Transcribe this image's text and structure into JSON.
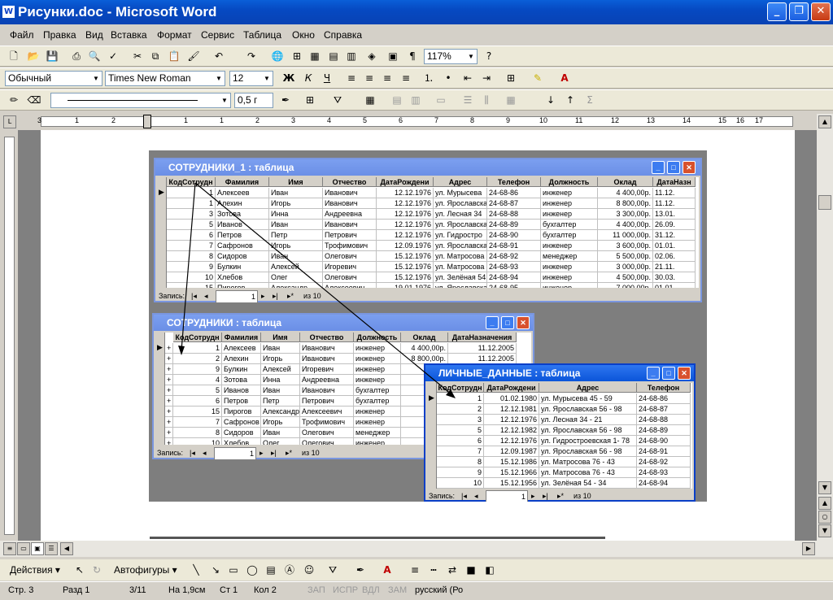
{
  "window": {
    "title": "Рисунки.doc - Microsoft Word"
  },
  "menu": [
    "Файл",
    "Правка",
    "Вид",
    "Вставка",
    "Формат",
    "Сервис",
    "Таблица",
    "Окно",
    "Справка"
  ],
  "toolbar": {
    "zoom": "117%"
  },
  "formatting": {
    "style": "Обычный",
    "font": "Times New Roman",
    "size": "12"
  },
  "drawing_line": {
    "weight": "0,5 г"
  },
  "ruler": {
    "numbers": [
      "3",
      "1",
      "2",
      "1",
      "1",
      "2",
      "3",
      "4",
      "5",
      "6",
      "7",
      "8",
      "9",
      "10",
      "11",
      "12",
      "13",
      "14",
      "15",
      "16",
      "17"
    ]
  },
  "w1": {
    "title": "СОТРУДНИКИ_1 : таблица",
    "headers": [
      "КодСотрудн",
      "Фамилия",
      "Имя",
      "Отчество",
      "ДатаРождени",
      "Адрес",
      "Телефон",
      "Должность",
      "Оклад",
      "ДатаНазн"
    ],
    "rows": [
      [
        "1",
        "Алексеев",
        "Иван",
        "Иванович",
        "12.12.1976",
        "ул. Мурысева",
        "24-68-86",
        "инженер",
        "4 400,00р.",
        "11.12."
      ],
      [
        "1",
        "Алехин",
        "Игорь",
        "Иванович",
        "12.12.1976",
        "ул. Ярославска",
        "24-68-87",
        "инженер",
        "8 800,00р.",
        "11.12."
      ],
      [
        "3",
        "Зотова",
        "Инна",
        "Андреевна",
        "12.12.1976",
        "ул. Лесная 34",
        "24-68-88",
        "инженер",
        "3 300,00р.",
        "13.01."
      ],
      [
        "5",
        "Иванов",
        "Иван",
        "Иванович",
        "12.12.1976",
        "ул. Ярославска",
        "24-68-89",
        "бухгалтер",
        "4 400,00р.",
        "26.09."
      ],
      [
        "6",
        "Петров",
        "Петр",
        "Петрович",
        "12.12.1976",
        "ул. Гидростро",
        "24-68-90",
        "бухгалтер",
        "11 000,00р.",
        "31.12."
      ],
      [
        "7",
        "Сафронов",
        "Игорь",
        "Трофимович",
        "12.09.1976",
        "ул. Ярославска",
        "24-68-91",
        "инженер",
        "3 600,00р.",
        "01.01."
      ],
      [
        "8",
        "Сидоров",
        "Иван",
        "Олегович",
        "15.12.1976",
        "ул. Матросова",
        "24-68-92",
        "менеджер",
        "5 500,00р.",
        "02.06."
      ],
      [
        "9",
        "Булкин",
        "Алексей",
        "Игоревич",
        "15.12.1976",
        "ул. Матросова",
        "24-68-93",
        "инженер",
        "3 000,00р.",
        "21.11."
      ],
      [
        "10",
        "Хлебов",
        "Олег",
        "Олегович",
        "15.12.1976",
        "ул. Зелёная 54",
        "24-68-94",
        "инженер",
        "4 500,00р.",
        "30.03."
      ],
      [
        "15",
        "Пирогов",
        "Александр",
        "Алексеевич",
        "19.01.1976",
        "ул. Ярославска",
        "24-68-95",
        "инженер",
        "7 000,00р.",
        "01.01."
      ]
    ],
    "nav_label": "Запись:",
    "nav_pos": "1",
    "nav_of": "из 10"
  },
  "w2": {
    "title": "СОТРУДНИКИ : таблица",
    "headers": [
      "КодСотрудн",
      "Фамилия",
      "Имя",
      "Отчество",
      "Должность",
      "Оклад",
      "ДатаНазначения"
    ],
    "rows": [
      [
        "1",
        "Алексеев",
        "Иван",
        "Иванович",
        "инженер",
        "4 400,00р.",
        "11.12.2005"
      ],
      [
        "2",
        "Алехин",
        "Игорь",
        "Иванович",
        "инженер",
        "8 800,00р.",
        "11.12.2005"
      ],
      [
        "9",
        "Булкин",
        "Алексей",
        "Игоревич",
        "инженер",
        "3 0",
        ""
      ],
      [
        "4",
        "Зотова",
        "Инна",
        "Андреевна",
        "инженер",
        "3 3",
        ""
      ],
      [
        "5",
        "Иванов",
        "Иван",
        "Иванович",
        "бухгалтер",
        "4 4",
        ""
      ],
      [
        "6",
        "Петров",
        "Петр",
        "Петрович",
        "бухгалтер",
        "11 0",
        ""
      ],
      [
        "15",
        "Пирогов",
        "Александр",
        "Алексеевич",
        "инженер",
        "7 0",
        ""
      ],
      [
        "7",
        "Сафронов",
        "Игорь",
        "Трофимович",
        "инженер",
        "3 6",
        ""
      ],
      [
        "8",
        "Сидоров",
        "Иван",
        "Олегович",
        "менеджер",
        "5 5",
        ""
      ],
      [
        "10",
        "Хлебов",
        "Олег",
        "Олегович",
        "инженер",
        "4 4",
        ""
      ]
    ],
    "nav_label": "Запись:",
    "nav_pos": "1",
    "nav_of": "из 10"
  },
  "w3": {
    "title": "ЛИЧНЫЕ_ДАННЫЕ : таблица",
    "headers": [
      "КодСотрудн",
      "ДатаРождени",
      "Адрес",
      "Телефон"
    ],
    "rows": [
      [
        "1",
        "01.02.1980",
        "ул. Мурысева 45 - 59",
        "24-68-86"
      ],
      [
        "2",
        "12.12.1981",
        "ул. Ярославская 56 - 98",
        "24-68-87"
      ],
      [
        "3",
        "12.12.1976",
        "ул. Лесная 34 - 21",
        "24-68-88"
      ],
      [
        "5",
        "12.12.1982",
        "ул. Ярославская 56 - 98",
        "24-68-89"
      ],
      [
        "6",
        "12.12.1976",
        "ул. Гидростроевская 1- 78",
        "24-68-90"
      ],
      [
        "7",
        "12.09.1987",
        "ул. Ярославская 56 - 98",
        "24-68-91"
      ],
      [
        "8",
        "15.12.1986",
        "ул. Матросова 76 - 43",
        "24-68-92"
      ],
      [
        "9",
        "15.12.1966",
        "ул. Матросова 76 - 43",
        "24-68-93"
      ],
      [
        "10",
        "15.12.1956",
        "ул. Зелёная 54 - 34",
        "24-68-94"
      ]
    ],
    "nav_label": "Запись:",
    "nav_pos": "1",
    "nav_of": "из 10"
  },
  "drawtb": {
    "actions": "Действия",
    "autoshapes": "Автофигуры"
  },
  "status": {
    "page": "Стр. 3",
    "section": "Разд 1",
    "pages": "3/11",
    "at": "На 1,9см",
    "line": "Ст 1",
    "col": "Кол 2",
    "rec": "ЗАП",
    "trk": "ИСПР",
    "ext": "ВДЛ",
    "ovr": "ЗАМ",
    "lang": "русский (Ро"
  }
}
